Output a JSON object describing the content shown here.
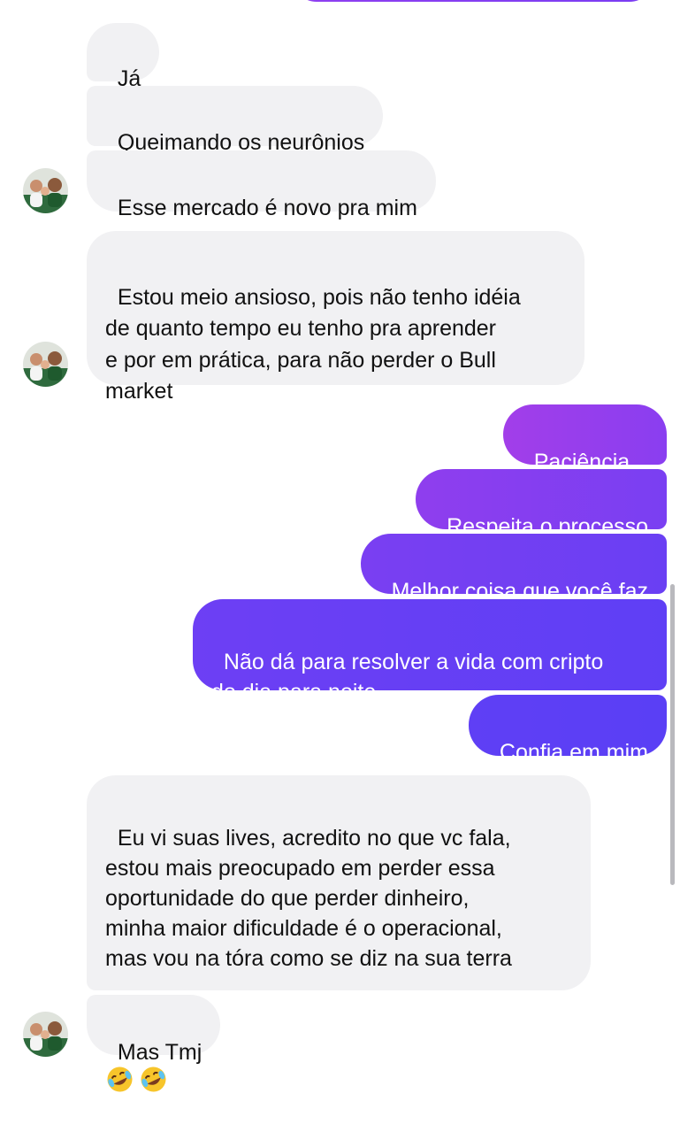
{
  "conversation": {
    "incoming": [
      {
        "id": "in1",
        "text": "Já"
      },
      {
        "id": "in2",
        "text": "Queimando os neurônios"
      },
      {
        "id": "in3",
        "text": "Esse mercado é novo pra mim"
      },
      {
        "id": "in4",
        "text": "Estou meio ansioso, pois não tenho idéia\nde quanto tempo eu tenho pra aprender\ne por em prática, para não perder o Bull\nmarket"
      },
      {
        "id": "in5",
        "text": "Eu vi suas lives, acredito no que vc fala,\nestou mais preocupado em perder essa\noportunidade do que perder dinheiro,\nminha maior dificuldade é o operacional,\nmas vou na tóra como se diz na sua terra",
        "emoji": [
          "rolling-on-floor-laughing",
          "rolling-on-floor-laughing"
        ]
      },
      {
        "id": "in6",
        "text": "Mas Tmj"
      }
    ],
    "outgoing": [
      {
        "id": "out1",
        "text": "Paciência .."
      },
      {
        "id": "out2",
        "text": "Respeita o processo"
      },
      {
        "id": "out3",
        "text": "Melhor coisa que você faz"
      },
      {
        "id": "out4",
        "text": "Não dá para resolver a vida com cripto\ndo dia para noite"
      },
      {
        "id": "out5",
        "text": "Confia em mim"
      }
    ]
  },
  "colors": {
    "incoming_bubble": "#f1f1f3",
    "outgoing_gradient_start": "#b040e8",
    "outgoing_gradient_end": "#5a3ff5"
  },
  "icons": {
    "avatar": "contact-avatar-photo",
    "emoji": "rolling-on-floor-laughing-emoji"
  }
}
